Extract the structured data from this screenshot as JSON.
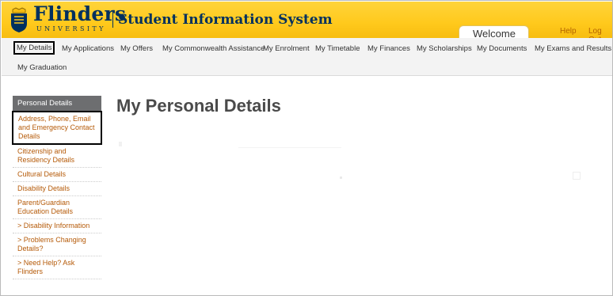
{
  "header": {
    "brand_name": "Flinders",
    "brand_sub": "UNIVERSITY",
    "system_title": "Student Information System",
    "welcome": "Welcome",
    "help": "Help",
    "logout": "Log Out",
    "accent": "#ffc91c",
    "brand_color": "#00305f"
  },
  "nav": {
    "items": [
      {
        "label": "My Details",
        "active": true
      },
      {
        "label": "My Applications"
      },
      {
        "label": "My Offers"
      },
      {
        "label": "My Commonwealth Assistance"
      },
      {
        "label": "My Enrolment"
      },
      {
        "label": "My Timetable"
      },
      {
        "label": "My Finances"
      },
      {
        "label": "My Scholarships"
      },
      {
        "label": "My Documents"
      },
      {
        "label": "My Exams and Results"
      },
      {
        "label": "My Graduation"
      }
    ]
  },
  "sidebar": {
    "heading": "Personal Details",
    "items": [
      {
        "label": "Address, Phone, Email and Emergency Contact Details",
        "selected": true
      },
      {
        "label": "Citizenship and Residency Details"
      },
      {
        "label": "Cultural Details"
      },
      {
        "label": "Disability Details"
      },
      {
        "label": "Parent/Guardian Education Details"
      },
      {
        "label": "> Disability Information"
      },
      {
        "label": "> Problems Changing Details?"
      },
      {
        "label": "> Need Help? Ask Flinders"
      }
    ],
    "link_color": "#b55a08"
  },
  "main": {
    "title": "My Personal Details"
  }
}
